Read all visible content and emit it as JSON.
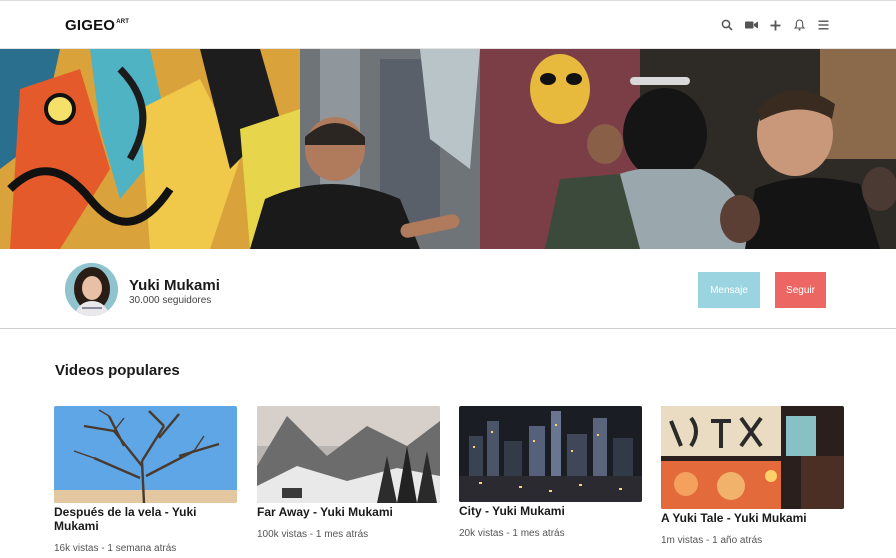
{
  "brand": {
    "name": "GIGEO",
    "sup": "ART"
  },
  "header_icons": [
    "search-icon",
    "video-camera-icon",
    "plus-icon",
    "bell-icon",
    "menu-icon"
  ],
  "profile": {
    "name": "Yuki Mukami",
    "followers": "30.000 seguidores",
    "message_label": "Mensaje",
    "follow_label": "Seguir"
  },
  "colors": {
    "message_button": "#9ad4e0",
    "follow_button": "#ec6664"
  },
  "section": {
    "title": "Videos populares"
  },
  "videos": [
    {
      "title": "Después de la vela - Yuki Mukami",
      "meta": "16k vistas - 1 semana atrás"
    },
    {
      "title": "Far Away - Yuki Mukami",
      "meta": "100k vistas - 1 mes atrás"
    },
    {
      "title": "City - Yuki Mukami",
      "meta": "20k vistas - 1 mes atrás"
    },
    {
      "title": "A Yuki Tale - Yuki Mukami",
      "meta": "1m vistas - 1 año atrás"
    }
  ]
}
